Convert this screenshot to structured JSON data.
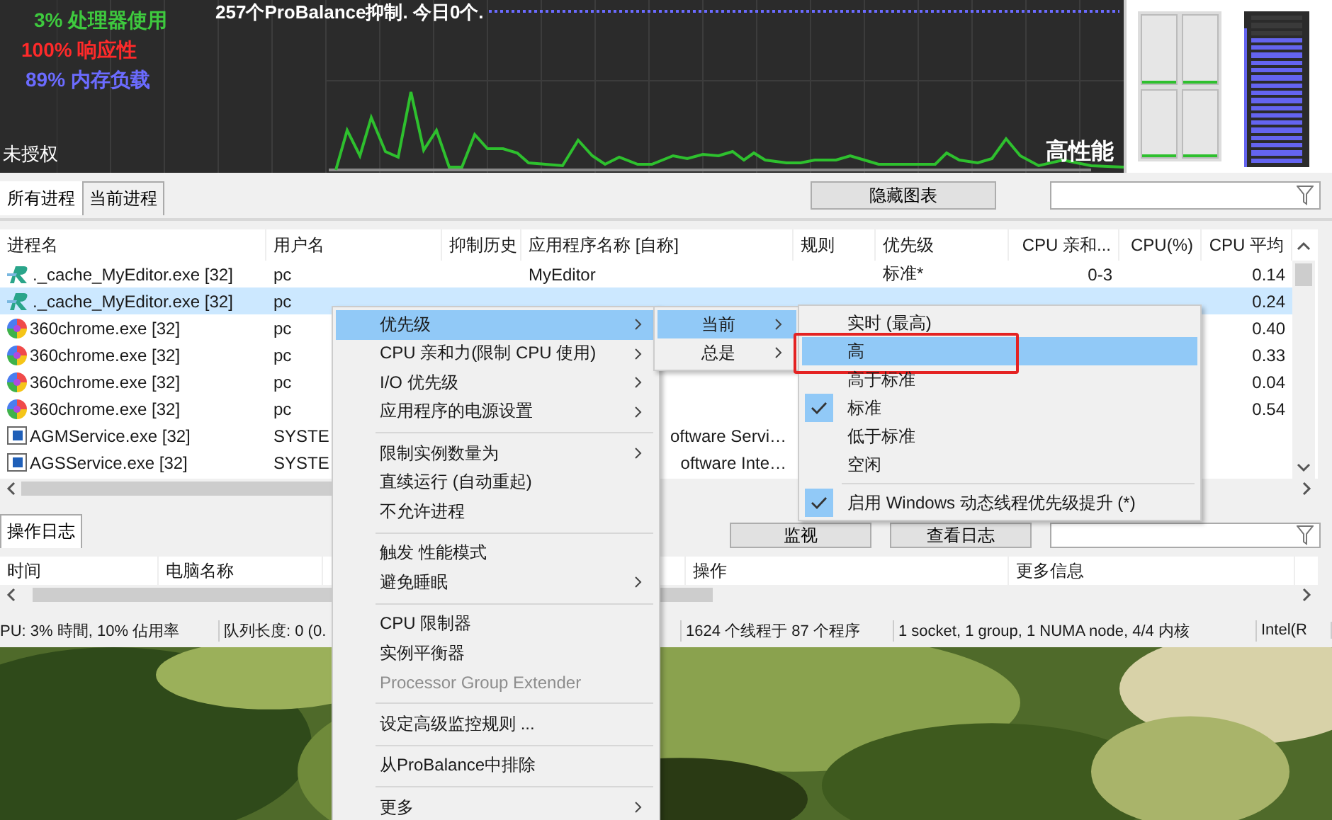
{
  "graph": {
    "cpu_text": "3% 处理器使用",
    "responsiveness_text": "100% 响应性",
    "memory_text": "89% 内存负载",
    "probalance_text": "257个ProBalance抑制. 今日0个.",
    "license_text": "未授权",
    "mode_text": "高性能"
  },
  "meters": {
    "cpu_cores": [
      {
        "level": 0.02
      },
      {
        "level": 0.02
      },
      {
        "level": 0.01
      },
      {
        "level": 0.02
      }
    ],
    "memory": {
      "level": 0.89
    }
  },
  "process_tabs": [
    {
      "label": "所有进程",
      "selected": true
    },
    {
      "label": "当前进程",
      "selected": false
    }
  ],
  "hide_chart_button": "隐藏图表",
  "table": {
    "columns": [
      {
        "label": "进程名"
      },
      {
        "label": "用户名"
      },
      {
        "label": "抑制历史"
      },
      {
        "label": "应用程序名称 [自称]"
      },
      {
        "label": "规则"
      },
      {
        "label": "优先级"
      },
      {
        "label": "CPU 亲和..."
      },
      {
        "label": "CPU(%)"
      },
      {
        "label": "CPU 平均"
      }
    ],
    "rows": [
      {
        "kind": "swoosh",
        "selected": false,
        "name": "._cache_MyEditor.exe [32]",
        "user": "pc",
        "app": "MyEditor",
        "app_truncated": false,
        "priority": "标准*",
        "affinity": "0-3",
        "cpu_avg": "0.14"
      },
      {
        "kind": "swoosh",
        "selected": true,
        "name": "._cache_MyEditor.exe [32]",
        "user": "pc",
        "cpu_avg": "0.24"
      },
      {
        "kind": "pinwheel",
        "selected": false,
        "name": "360chrome.exe [32]",
        "user": "pc",
        "cpu_avg": "0.40"
      },
      {
        "kind": "pinwheel",
        "selected": false,
        "name": "360chrome.exe [32]",
        "user": "pc",
        "cpu_avg": "0.33"
      },
      {
        "kind": "pinwheel",
        "selected": false,
        "name": "360chrome.exe [32]",
        "user": "pc",
        "cpu_avg": "0.04"
      },
      {
        "kind": "pinwheel",
        "selected": false,
        "name": "360chrome.exe [32]",
        "user": "pc",
        "cpu_avg": "0.54"
      },
      {
        "kind": "window",
        "selected": false,
        "name": "AGMService.exe [32]",
        "user": "SYSTE",
        "app": "oftware Servi…",
        "app_truncated": true
      },
      {
        "kind": "window",
        "selected": false,
        "name": "AGSService.exe [32]",
        "user": "SYSTE",
        "app": "oftware Inte…",
        "app_truncated": true
      }
    ]
  },
  "log_tabs": [
    {
      "label": "操作日志",
      "selected": true
    }
  ],
  "log_buttons": [
    "监视",
    "查看日志"
  ],
  "log_columns": [
    {
      "label": "时间"
    },
    {
      "label": "电脑名称"
    },
    {},
    {
      "label": "操作"
    },
    {
      "label": "更多信息"
    }
  ],
  "status_bar": [
    "PU: 3% 時間, 10% 佔用率",
    "队列长度: 0 (0.",
    "1624 个线程于 87 个程序",
    "1 socket, 1 group, 1 NUMA node, 4/4 内核",
    "Intel(R"
  ],
  "context_menu": {
    "items": [
      {
        "kind": "item",
        "label": "优先级",
        "submenu": true,
        "highlighted": true,
        "disabled": false
      },
      {
        "kind": "item",
        "label": "CPU 亲和力(限制 CPU 使用)",
        "submenu": true,
        "highlighted": false,
        "disabled": false
      },
      {
        "kind": "item",
        "label": "I/O 优先级",
        "submenu": true,
        "highlighted": false,
        "disabled": false
      },
      {
        "kind": "item",
        "label": "应用程序的电源设置",
        "submenu": true,
        "highlighted": false,
        "disabled": false
      },
      {
        "kind": "separator"
      },
      {
        "kind": "item",
        "label": "限制实例数量为",
        "submenu": true,
        "highlighted": false,
        "disabled": false
      },
      {
        "kind": "item",
        "label": "直续运行 (自动重起)",
        "submenu": false,
        "highlighted": false,
        "disabled": false
      },
      {
        "kind": "item",
        "label": "不允许进程",
        "submenu": false,
        "highlighted": false,
        "disabled": false
      },
      {
        "kind": "separator"
      },
      {
        "kind": "item",
        "label": "触发 性能模式",
        "submenu": false,
        "highlighted": false,
        "disabled": false
      },
      {
        "kind": "item",
        "label": "避免睡眠",
        "submenu": true,
        "highlighted": false,
        "disabled": false
      },
      {
        "kind": "separator"
      },
      {
        "kind": "item",
        "label": "CPU 限制器",
        "submenu": false,
        "highlighted": false,
        "disabled": false
      },
      {
        "kind": "item",
        "label": "实例平衡器",
        "submenu": false,
        "highlighted": false,
        "disabled": false
      },
      {
        "kind": "item",
        "label": "Processor Group Extender",
        "submenu": false,
        "highlighted": false,
        "disabled": true
      },
      {
        "kind": "separator"
      },
      {
        "kind": "item",
        "label": "设定高级监控规则 ...",
        "submenu": false,
        "highlighted": false,
        "disabled": false
      },
      {
        "kind": "separator"
      },
      {
        "kind": "item",
        "label": "从ProBalance中排除",
        "submenu": false,
        "highlighted": false,
        "disabled": false
      },
      {
        "kind": "separator"
      },
      {
        "kind": "item",
        "label": "更多",
        "submenu": true,
        "highlighted": false,
        "disabled": false
      }
    ]
  },
  "priority_submenu": {
    "items": [
      {
        "label": "当前",
        "highlighted": true
      },
      {
        "label": "总是",
        "highlighted": false
      }
    ]
  },
  "priority_levels": {
    "items": [
      {
        "kind": "item",
        "label": "实时 (最高)",
        "checked": false,
        "highlighted": false,
        "annotated": false
      },
      {
        "kind": "item",
        "label": "高",
        "checked": false,
        "highlighted": true,
        "annotated": true
      },
      {
        "kind": "item",
        "label": "高于标准",
        "checked": false,
        "highlighted": false,
        "annotated": false
      },
      {
        "kind": "item",
        "label": "标准",
        "checked": true,
        "highlighted": false,
        "annotated": false
      },
      {
        "kind": "item",
        "label": "低于标准",
        "checked": false,
        "highlighted": false,
        "annotated": false
      },
      {
        "kind": "item",
        "label": "空闲",
        "checked": false,
        "highlighted": false,
        "annotated": false
      },
      {
        "kind": "separator"
      },
      {
        "kind": "item",
        "label": "启用 Windows 动态线程优先级提升 (*)",
        "checked": true,
        "highlighted": false,
        "annotated": false
      }
    ]
  }
}
